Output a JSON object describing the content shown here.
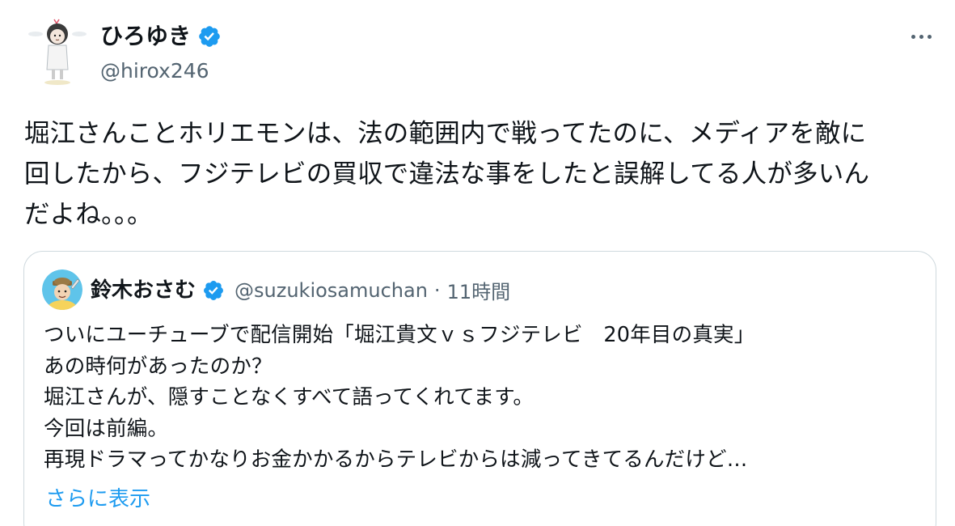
{
  "author": {
    "display_name": "ひろゆき",
    "handle": "@hirox246",
    "verified": true,
    "avatar_icon": "avatar-illustration-icon"
  },
  "tweet": {
    "text": "堀江さんことホリエモンは、法の範囲内で戦ってたのに、メディアを敵に\n回したから、フジテレビの買収で違法な事をしたと誤解してる人が多いん\nだよね。。。"
  },
  "quote": {
    "display_name": "鈴木おさむ",
    "handle": "@suzukiosamuchan",
    "separator": "·",
    "time": "11時間",
    "lines": [
      "ついにユーチューブで配信開始「堀江貴文ｖｓフジテレビ　20年目の真実」",
      "あの時何があったのか？",
      "堀江さんが、隠すことなくすべて語ってくれてます。",
      "今回は前編。",
      "再現ドラマってかなりお金かかるからテレビからは減ってきてるんだけど…"
    ],
    "show_more": "さらに表示"
  },
  "colors": {
    "verified_blue": "#1d9bf0",
    "link_blue": "#1d9bf0",
    "secondary_text": "#536471",
    "border": "#cfd9de"
  }
}
